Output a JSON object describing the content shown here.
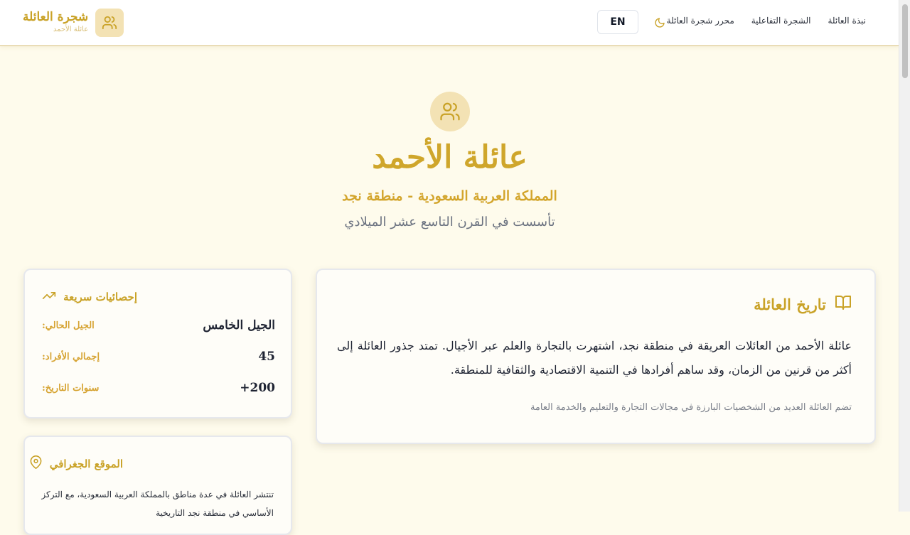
{
  "header": {
    "brand_title": "شجرة العائلة",
    "brand_subtitle": "عائلة الأحمد",
    "brand_icon": "users-icon",
    "lang_button": "EN",
    "theme_icon": "moon-icon",
    "nav": [
      "نبذة العائلة",
      "الشجرة التفاعلية",
      "محرر شجرة العائلة"
    ]
  },
  "hero": {
    "icon": "users-icon",
    "title": "عائلة الأحمد",
    "location": "المملكة العربية السعودية - منطقة نجد",
    "founded": "تأسست في القرن التاسع عشر الميلادي"
  },
  "history": {
    "icon": "book-open-icon",
    "title": "تاريخ العائلة",
    "body": "عائلة الأحمد من العائلات العريقة في منطقة نجد، اشتهرت بالتجارة والعلم عبر الأجيال. تمتد جذور العائلة إلى أكثر من قرنين من الزمان، وقد ساهم أفرادها في التنمية الاقتصادية والثقافية للمنطقة.",
    "note": "تضم العائلة العديد من الشخصيات البارزة في مجالات التجارة والتعليم والخدمة العامة"
  },
  "stats": {
    "icon": "trending-up-icon",
    "title": "إحصائيات سريعة",
    "rows": [
      {
        "label": "الجيل الحالي:",
        "value": "الجيل الخامس"
      },
      {
        "label": "إجمالي الأفراد:",
        "value": "45"
      },
      {
        "label": "سنوات التاريخ:",
        "value": "200+"
      }
    ]
  },
  "geo": {
    "icon": "map-pin-icon",
    "title": "الموقع الجغرافي",
    "body": "تنتشر العائلة في عدة مناطق بالمملكة العربية السعودية، مع التركز الأساسي في منطقة نجد التاريخية"
  },
  "colors": {
    "accent": "#c9a227",
    "background": "#fefbec",
    "icon_bg": "#f3e2b4"
  }
}
